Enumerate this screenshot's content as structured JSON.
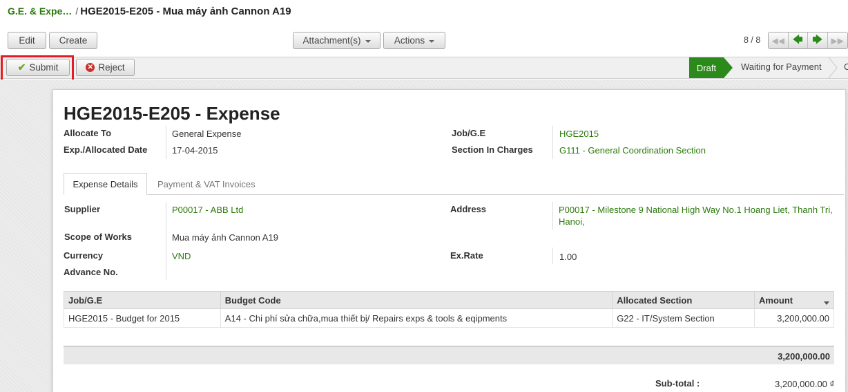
{
  "breadcrumb": {
    "parent": "G.E. & Expe…",
    "separator": "/",
    "current": "HGE2015-E205 - Mua máy ảnh Cannon A19"
  },
  "toolbar": {
    "edit": "Edit",
    "create": "Create",
    "attachments": "Attachment(s)",
    "actions": "Actions",
    "pager": "8 / 8"
  },
  "statusbar": {
    "submit": "Submit",
    "reject": "Reject",
    "stages": [
      "Draft",
      "Waiting for Payment",
      "C"
    ]
  },
  "form": {
    "title": "HGE2015-E205 -  Expense",
    "allocate_to_label": "Allocate To",
    "allocate_to": "General Expense",
    "date_label": "Exp./Allocated Date",
    "date": "17-04-2015",
    "job_label": "Job/G.E",
    "job": "HGE2015",
    "section_label": "Section In Charges",
    "section": "G111 - General Coordination Section"
  },
  "tabs": [
    "Expense Details",
    "Payment & VAT Invoices"
  ],
  "details": {
    "supplier_label": "Supplier",
    "supplier": "P00017 - ABB Ltd",
    "address_label": "Address",
    "address_line1": "P00017 - Milestone 9 National High Way No.1 Hoang Liet, Thanh Tri,",
    "address_line2": "Hanoi,",
    "scope_label": "Scope of Works",
    "scope": "Mua máy ảnh Cannon A19",
    "currency_label": "Currency",
    "currency": "VND",
    "exrate_label": "Ex.Rate",
    "exrate": "1.00",
    "advance_label": "Advance No.",
    "advance": ""
  },
  "lines": {
    "headers": [
      "Job/G.E",
      "Budget Code",
      "Allocated Section",
      "Amount"
    ],
    "rows": [
      [
        "HGE2015 - Budget for 2015",
        "A14 - Chi phí sửa chữa,mua thiết bị/ Repairs exps & tools & eqipments",
        "G22 - IT/System Section",
        "3,200,000.00"
      ]
    ],
    "total": "3,200,000.00"
  },
  "summary": {
    "subtotal_label": "Sub-total :",
    "subtotal": "3,200,000.00 ₫"
  }
}
